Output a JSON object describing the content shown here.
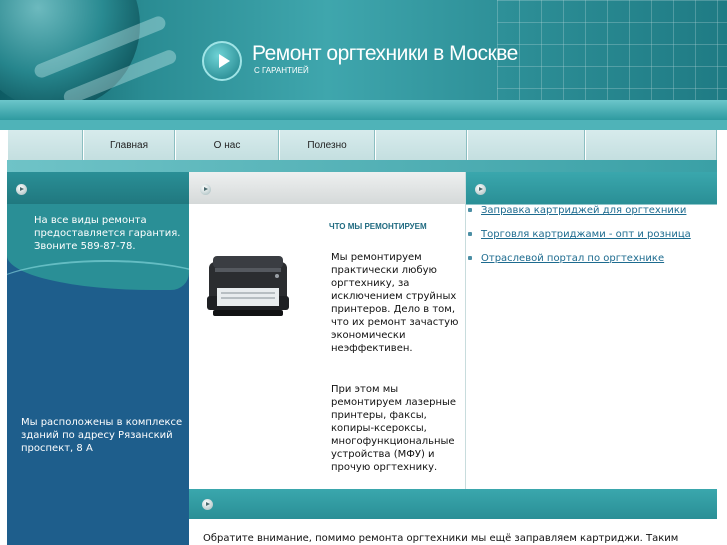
{
  "header": {
    "title": "Ремонт оргтехники в Москве",
    "subtitle": "С ГАРАНТИЕЙ"
  },
  "nav": {
    "items": [
      {
        "label": ""
      },
      {
        "label": "Главная"
      },
      {
        "label": "О нас"
      },
      {
        "label": "Полезно"
      },
      {
        "label": ""
      },
      {
        "label": ""
      },
      {
        "label": ""
      }
    ]
  },
  "left": {
    "text1": "На все виды ремонта предоставляется гарантия. Звоните 589-87-78.",
    "text2": "Мы расположены в комплексе зданий по адресу Рязанский проспект, 8 А"
  },
  "main": {
    "heading": "ЧТО МЫ РЕМОНТИРУЕМ",
    "p1": "Мы ремонтируем практически любую оргтехнику, за исключением струйных принтеров. Дело в том, что их ремонт зачастую экономически неэффективен.",
    "p2": "При этом мы ремонтируем лазерные принтеры, факсы, копиры-ксероксы, многофункциональные устройства (МФУ) и прочую оргтехнику."
  },
  "links": [
    {
      "label": "Заправка картриджей для оргтехники"
    },
    {
      "label": "Торговля картриджами - опт и розница"
    },
    {
      "label": "Отраслевой портал по оргтехнике"
    }
  ],
  "bottom": {
    "text": "Обратите внимание, помимо ремонта оргтехники мы ещё заправляем картриджи. Таким"
  },
  "colors": {
    "teal": "#2a8f96",
    "navy": "#1e5e8c",
    "link": "#1d6b8f"
  }
}
